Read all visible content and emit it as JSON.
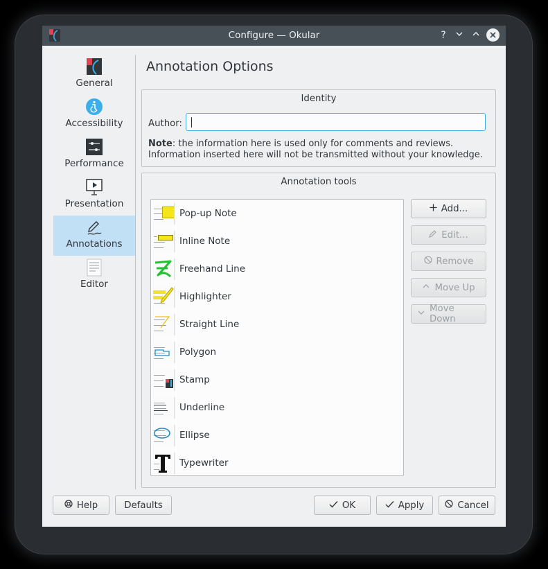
{
  "window": {
    "title": "Configure — Okular",
    "help_glyph": "?",
    "min_glyph": "⌄",
    "max_glyph": "⌃",
    "close_glyph": "✕"
  },
  "sidebar": {
    "items": [
      {
        "label": "General",
        "icon": "okular-app-icon"
      },
      {
        "label": "Accessibility",
        "icon": "accessibility-icon"
      },
      {
        "label": "Performance",
        "icon": "performance-sliders-icon"
      },
      {
        "label": "Presentation",
        "icon": "presentation-icon"
      },
      {
        "label": "Annotations",
        "icon": "annotations-pen-icon",
        "active": true
      },
      {
        "label": "Editor",
        "icon": "editor-document-icon"
      }
    ]
  },
  "page": {
    "title": "Annotation Options"
  },
  "identity": {
    "title": "Identity",
    "author_label": "Author:",
    "author_value": "",
    "note_bold": "Note",
    "note_line1": ": the information here is used only for comments and reviews.",
    "note_line2": "Information inserted here will not be transmitted without your knowledge."
  },
  "tools": {
    "title": "Annotation tools",
    "items": [
      {
        "label": "Pop-up Note",
        "icon": "popup-note-icon"
      },
      {
        "label": "Inline Note",
        "icon": "inline-note-icon"
      },
      {
        "label": "Freehand Line",
        "icon": "freehand-line-icon"
      },
      {
        "label": "Highlighter",
        "icon": "highlighter-icon"
      },
      {
        "label": "Straight Line",
        "icon": "straight-line-icon"
      },
      {
        "label": "Polygon",
        "icon": "polygon-icon"
      },
      {
        "label": "Stamp",
        "icon": "stamp-icon"
      },
      {
        "label": "Underline",
        "icon": "underline-icon"
      },
      {
        "label": "Ellipse",
        "icon": "ellipse-icon"
      },
      {
        "label": "Typewriter",
        "icon": "typewriter-icon"
      }
    ],
    "buttons": {
      "add": "Add...",
      "edit": "Edit...",
      "remove": "Remove",
      "move_up": "Move Up",
      "move_down": "Move Down"
    }
  },
  "footer": {
    "help": "Help",
    "defaults": "Defaults",
    "ok": "OK",
    "apply": "Apply",
    "cancel": "Cancel"
  },
  "colors": {
    "accent": "#3daee9",
    "titlebar": "#475057",
    "selection": "#c2e0f5",
    "window_bg": "#eff0f1"
  }
}
